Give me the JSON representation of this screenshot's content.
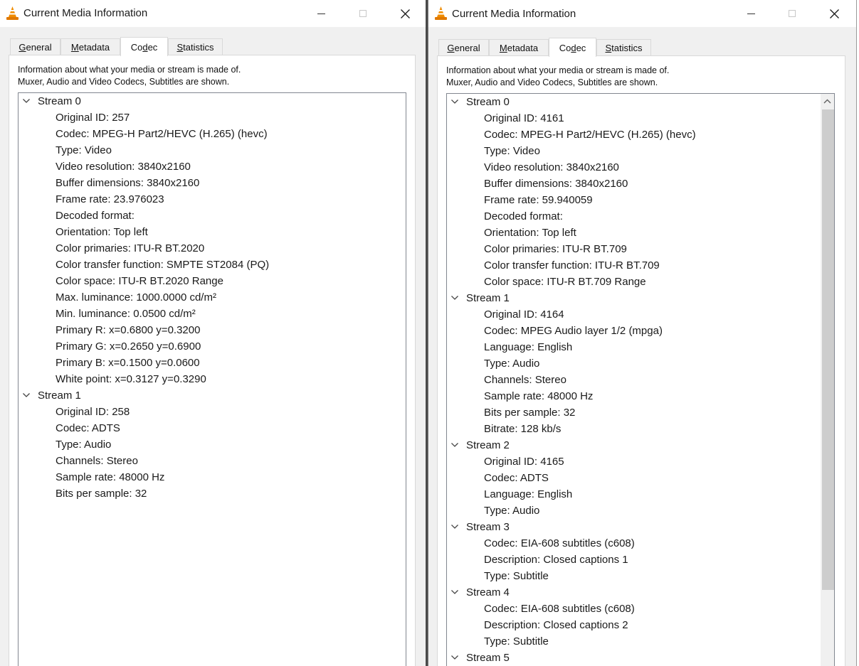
{
  "left_window": {
    "title": "Current Media Information",
    "tabs": [
      {
        "label": "General",
        "u": "G",
        "rest": "eneral"
      },
      {
        "label": "Metadata",
        "u": "M",
        "rest": "etadata"
      },
      {
        "pre": "Co",
        "u": "d",
        "rest": "ec",
        "label": "Codec"
      },
      {
        "label": "Statistics",
        "u": "S",
        "rest": "tatistics"
      }
    ],
    "active_tab": "Codec",
    "description_line1": "Information about what your media or stream is made of.",
    "description_line2": "Muxer, Audio and Video Codecs, Subtitles are shown.",
    "streams": [
      {
        "label": "Stream 0",
        "items": [
          "Original ID: 257",
          "Codec: MPEG-H Part2/HEVC (H.265) (hevc)",
          "Type: Video",
          "Video resolution: 3840x2160",
          "Buffer dimensions: 3840x2160",
          "Frame rate: 23.976023",
          "Decoded format:",
          "Orientation: Top left",
          "Color primaries: ITU-R BT.2020",
          "Color transfer function: SMPTE ST2084 (PQ)",
          "Color space: ITU-R BT.2020 Range",
          "Max. luminance: 1000.0000 cd/m²",
          "Min. luminance: 0.0500 cd/m²",
          "Primary R: x=0.6800 y=0.3200",
          "Primary G: x=0.2650 y=0.6900",
          "Primary B: x=0.1500 y=0.0600",
          "White point: x=0.3127 y=0.3290"
        ]
      },
      {
        "label": "Stream 1",
        "items": [
          "Original ID: 258",
          "Codec: ADTS",
          "Type: Audio",
          "Channels: Stereo",
          "Sample rate: 48000 Hz",
          "Bits per sample: 32"
        ]
      }
    ]
  },
  "right_window": {
    "title": "Current Media Information",
    "tabs": [
      {
        "label": "General",
        "u": "G",
        "rest": "eneral"
      },
      {
        "label": "Metadata",
        "u": "M",
        "rest": "etadata"
      },
      {
        "pre": "Co",
        "u": "d",
        "rest": "ec",
        "label": "Codec"
      },
      {
        "label": "Statistics",
        "u": "S",
        "rest": "tatistics"
      }
    ],
    "active_tab": "Codec",
    "description_line1": "Information about what your media or stream is made of.",
    "description_line2": "Muxer, Audio and Video Codecs, Subtitles are shown.",
    "streams": [
      {
        "label": "Stream 0",
        "items": [
          "Original ID: 4161",
          "Codec: MPEG-H Part2/HEVC (H.265) (hevc)",
          "Type: Video",
          "Video resolution: 3840x2160",
          "Buffer dimensions: 3840x2160",
          "Frame rate: 59.940059",
          "Decoded format:",
          "Orientation: Top left",
          "Color primaries: ITU-R BT.709",
          "Color transfer function: ITU-R BT.709",
          "Color space: ITU-R BT.709 Range"
        ]
      },
      {
        "label": "Stream 1",
        "items": [
          "Original ID: 4164",
          "Codec: MPEG Audio layer 1/2 (mpga)",
          "Language: English",
          "Type: Audio",
          "Channels: Stereo",
          "Sample rate: 48000 Hz",
          "Bits per sample: 32",
          "Bitrate: 128 kb/s"
        ]
      },
      {
        "label": "Stream 2",
        "items": [
          "Original ID: 4165",
          "Codec: ADTS",
          "Language: English",
          "Type: Audio"
        ]
      },
      {
        "label": "Stream 3",
        "items": [
          "Codec: EIA-608 subtitles (c608)",
          "Description: Closed captions 1",
          "Type: Subtitle"
        ]
      },
      {
        "label": "Stream 4",
        "items": [
          "Codec: EIA-608 subtitles (c608)",
          "Description: Closed captions 2",
          "Type: Subtitle"
        ]
      },
      {
        "label": "Stream 5",
        "items": []
      }
    ]
  },
  "icons": {
    "app": "vlc-cone-icon",
    "minimize": "minimize-icon",
    "maximize": "maximize-icon",
    "close": "close-icon",
    "expand": "chevron-down-icon",
    "scroll_up": "chevron-up-icon"
  },
  "colors": {
    "vlc_orange": "#f08c00",
    "window_bg": "#f0f0f0",
    "panel_bg": "#ffffff",
    "scroll_thumb": "#cdcdcd"
  }
}
